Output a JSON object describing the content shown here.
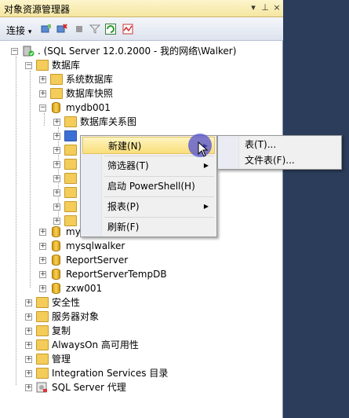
{
  "window": {
    "title": "对象资源管理器",
    "pin_symbol": "▾",
    "pin2_symbol": "⊥",
    "close_symbol": "×"
  },
  "toolbar": {
    "connect_label": "连接",
    "connect_arrow": "▾"
  },
  "tree": {
    "server": ". (SQL Server 12.0.2000 - 我的网络\\Walker)",
    "databases": "数据库",
    "system_databases": "系统数据库",
    "db_snapshots": "数据库快照",
    "mydb001": "mydb001",
    "db_diagrams": "数据库关系图",
    "my_truncated": "my",
    "mysqlwalker": "mysqlwalker",
    "reportserver": "ReportServer",
    "reportservertempdb": "ReportServerTempDB",
    "zxw001": "zxw001",
    "security": "安全性",
    "server_objects": "服务器对象",
    "replication": "复制",
    "alwayson": "AlwaysOn 高可用性",
    "management": "管理",
    "integration_services": "Integration Services 目录",
    "sql_agent": "SQL Server 代理"
  },
  "context_menu": {
    "items": [
      {
        "label": "新建(N)",
        "has_submenu": true
      },
      {
        "label": "筛选器(T)",
        "has_submenu": true
      },
      {
        "label": "启动 PowerShell(H)",
        "has_submenu": false
      },
      {
        "label": "报表(P)",
        "has_submenu": true
      },
      {
        "label": "刷新(F)",
        "has_submenu": false
      }
    ],
    "arrow_symbol": "▶"
  },
  "submenu": {
    "items": [
      {
        "label": "表(T)..."
      },
      {
        "label": "文件表(F)..."
      }
    ]
  },
  "colors": {
    "background": "#2b3d5b",
    "highlight": "#f9de7a",
    "folder": "#f3cc59"
  }
}
